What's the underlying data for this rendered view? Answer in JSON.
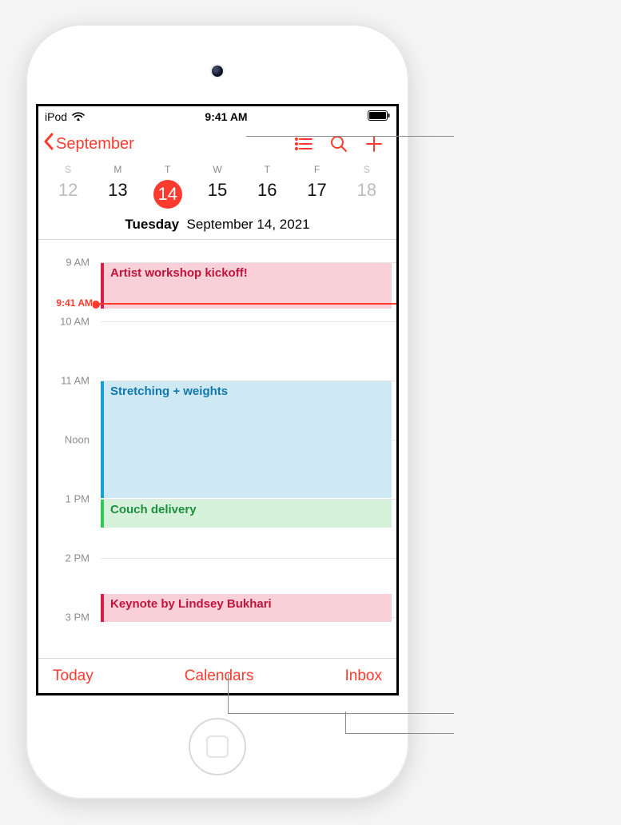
{
  "status_bar": {
    "carrier": "iPod",
    "time": "9:41 AM"
  },
  "nav": {
    "back_label": "September"
  },
  "week": {
    "dow": [
      "S",
      "M",
      "T",
      "W",
      "T",
      "F",
      "S"
    ],
    "days": [
      {
        "num": "12",
        "weekend": true,
        "selected": false
      },
      {
        "num": "13",
        "weekend": false,
        "selected": false
      },
      {
        "num": "14",
        "weekend": false,
        "selected": true
      },
      {
        "num": "15",
        "weekend": false,
        "selected": false
      },
      {
        "num": "16",
        "weekend": false,
        "selected": false
      },
      {
        "num": "17",
        "weekend": false,
        "selected": false
      },
      {
        "num": "18",
        "weekend": true,
        "selected": false
      }
    ],
    "weekday_label": "Tuesday",
    "full_date": "September 14, 2021"
  },
  "timeline": {
    "hours": [
      "9 AM",
      "10 AM",
      "11 AM",
      "Noon",
      "1 PM",
      "2 PM",
      "3 PM"
    ],
    "now_label": "9:41 AM",
    "events": [
      {
        "title": "Artist workshop kickoff!",
        "color_bar": "#d81e4a",
        "color_bg": "#f9d0d7",
        "color_text": "#c0143d"
      },
      {
        "title": "Stretching + weights",
        "color_bar": "#1a9ed9",
        "color_bg": "#cfe9f4",
        "color_text": "#1078ab"
      },
      {
        "title": "Couch delivery",
        "color_bar": "#34c759",
        "color_bg": "#d6f2db",
        "color_text": "#1e8f3e"
      },
      {
        "title": "Keynote by Lindsey Bukhari",
        "color_bar": "#d81e4a",
        "color_bg": "#f9d0d7",
        "color_text": "#c0143d"
      }
    ]
  },
  "toolbar": {
    "today": "Today",
    "calendars": "Calendars",
    "inbox": "Inbox"
  }
}
